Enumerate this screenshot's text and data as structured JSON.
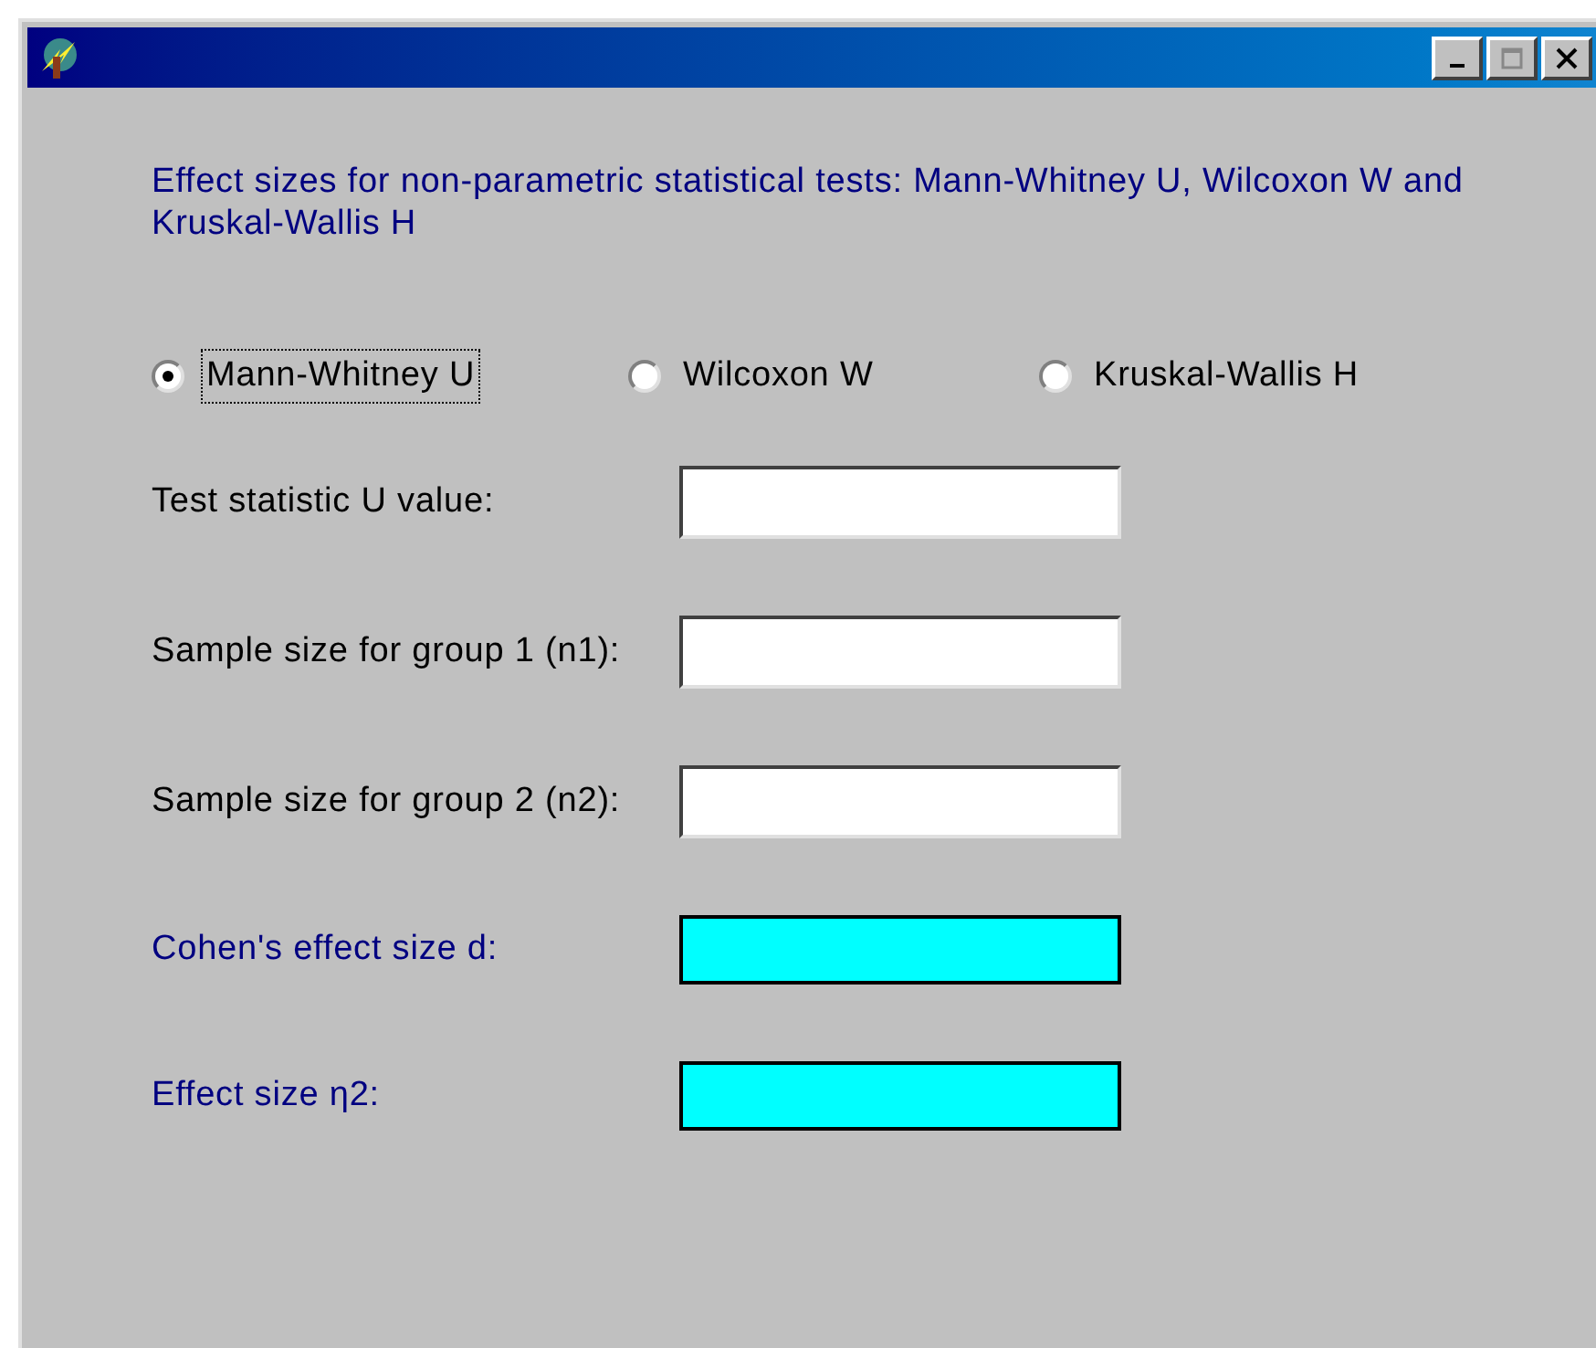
{
  "heading": "Effect sizes for non-parametric statistical tests: Mann-Whitney U, Wilcoxon W and Kruskal-Wallis H",
  "tests": [
    {
      "label": "Mann-Whitney U",
      "selected": true
    },
    {
      "label": "Wilcoxon W",
      "selected": false
    },
    {
      "label": "Kruskal-Wallis H",
      "selected": false
    }
  ],
  "fields": [
    {
      "kind": "input",
      "label": "Test statistic U value:"
    },
    {
      "kind": "input",
      "label": "Sample size for group 1 (n1):"
    },
    {
      "kind": "input",
      "label": "Sample size for group 2 (n2):"
    },
    {
      "kind": "output",
      "label": "Cohen's effect size d:"
    },
    {
      "kind": "output",
      "label": "Effect size  η2:"
    }
  ]
}
